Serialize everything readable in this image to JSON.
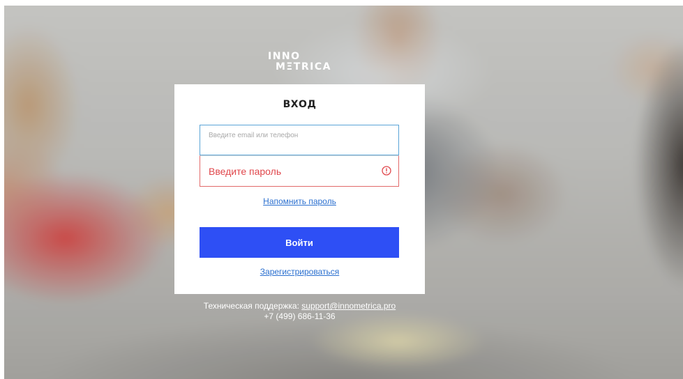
{
  "logo": {
    "line1": "INNO",
    "line2": "MΞTRICA"
  },
  "login": {
    "title": "ВХОД",
    "email_placeholder": "Введите email или телефон",
    "email_value": "",
    "password_placeholder": "Введите пароль",
    "password_value": "",
    "remind_link": "Напомнить пароль",
    "submit_label": "Войти",
    "register_link": "Зарегистрироваться"
  },
  "support": {
    "label": "Техническая поддержка:",
    "email": "support@innometrica.pro",
    "phone": "+7 (499) 686-11-36"
  },
  "colors": {
    "accent": "#2e4ff5",
    "error": "#e0474c",
    "link": "#2a6fcf",
    "focus_border": "#5aa4d6"
  },
  "icons": {
    "password_status": "error-circle-icon"
  }
}
